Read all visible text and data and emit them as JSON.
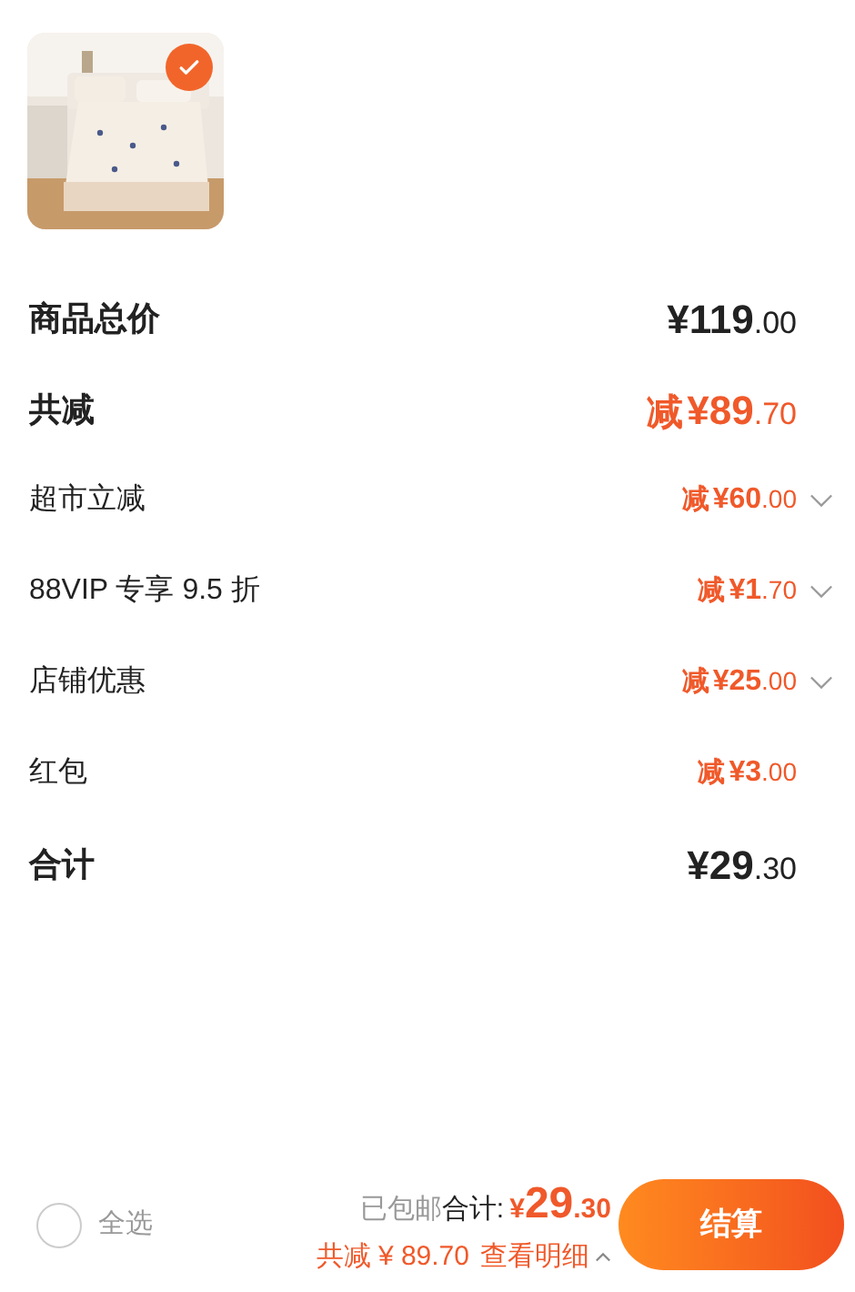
{
  "product": {
    "kind": "picture",
    "selected": true
  },
  "rows": [
    {
      "label": "商品总价",
      "kind": "heading",
      "accent": false,
      "prefix": "",
      "currency": "¥",
      "integer": "119",
      "fraction": ".00",
      "expandable": false
    },
    {
      "label": "共减",
      "kind": "heading",
      "accent": true,
      "prefix": "减",
      "currency": "¥",
      "integer": "89",
      "fraction": ".70",
      "expandable": false
    },
    {
      "label": "超市立减",
      "kind": "item",
      "accent": true,
      "prefix": "减",
      "currency": "¥",
      "integer": "60",
      "fraction": ".00",
      "expandable": true
    },
    {
      "label": "88VIP 专享 9.5 折",
      "kind": "item",
      "accent": true,
      "prefix": "减",
      "currency": "¥",
      "integer": "1",
      "fraction": ".70",
      "expandable": true
    },
    {
      "label": "店铺优惠",
      "kind": "item",
      "accent": true,
      "prefix": "减",
      "currency": "¥",
      "integer": "25",
      "fraction": ".00",
      "expandable": true
    },
    {
      "label": "红包",
      "kind": "item",
      "accent": true,
      "prefix": "减",
      "currency": "¥",
      "integer": "3",
      "fraction": ".00",
      "expandable": false
    },
    {
      "label": "合计",
      "kind": "heading",
      "accent": false,
      "prefix": "",
      "currency": "¥",
      "integer": "29",
      "fraction": ".30",
      "expandable": false
    }
  ],
  "footer": {
    "select_all": {
      "label": "全选",
      "checked": false
    },
    "shipping": "已包邮",
    "total_label": "合计:",
    "currency": "¥",
    "integer": "29",
    "fraction": ".30",
    "saved": "共减 ¥ 89.70",
    "details": "查看明细",
    "checkout": "结算"
  }
}
